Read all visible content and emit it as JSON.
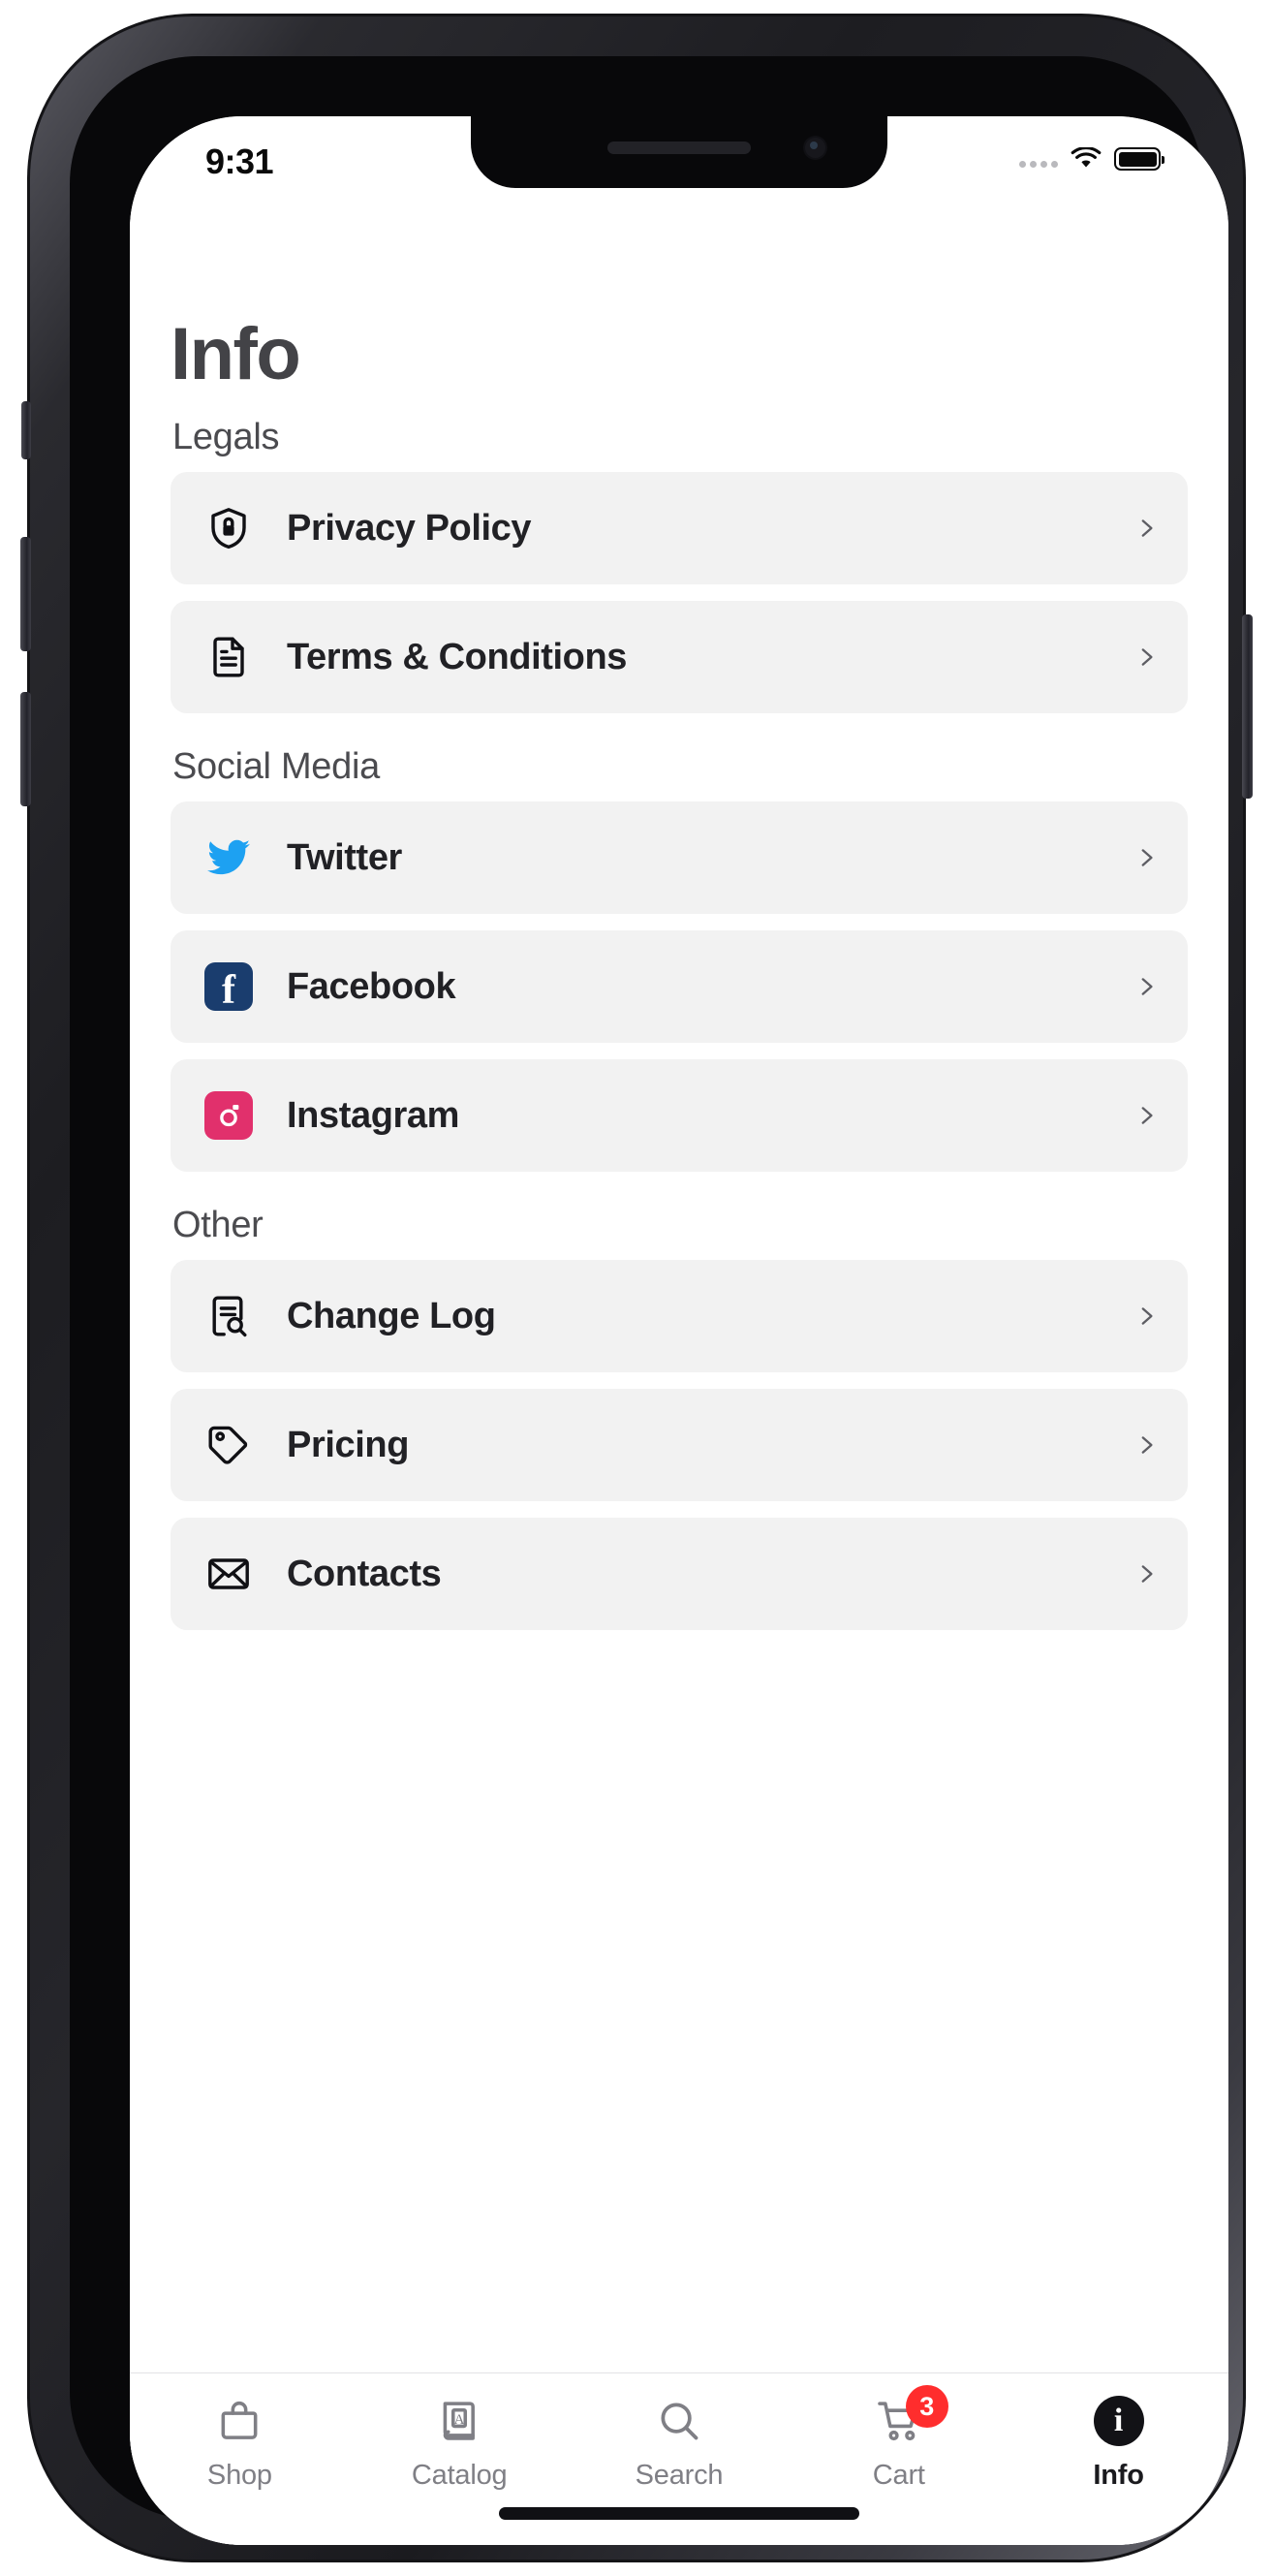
{
  "status_bar": {
    "time": "9:31",
    "signal_icon": "signal-dots-icon",
    "wifi_icon": "wifi-icon",
    "battery_icon": "battery-full-icon"
  },
  "page": {
    "title": "Info"
  },
  "sections": [
    {
      "header": "Legals",
      "rows": [
        {
          "label": "Privacy Policy",
          "icon": "shield-lock-icon",
          "chevron": "chevron-right-icon"
        },
        {
          "label": "Terms & Conditions",
          "icon": "document-icon",
          "chevron": "chevron-right-icon"
        }
      ]
    },
    {
      "header": "Social Media",
      "rows": [
        {
          "label": "Twitter",
          "icon": "twitter-icon",
          "chevron": "chevron-right-icon"
        },
        {
          "label": "Facebook",
          "icon": "facebook-icon",
          "chevron": "chevron-right-icon"
        },
        {
          "label": "Instagram",
          "icon": "instagram-icon",
          "chevron": "chevron-right-icon"
        }
      ]
    },
    {
      "header": "Other",
      "rows": [
        {
          "label": "Change Log",
          "icon": "document-search-icon",
          "chevron": "chevron-right-icon"
        },
        {
          "label": "Pricing",
          "icon": "price-tag-icon",
          "chevron": "chevron-right-icon"
        },
        {
          "label": "Contacts",
          "icon": "envelope-icon",
          "chevron": "chevron-right-icon"
        }
      ]
    }
  ],
  "tab_bar": {
    "tabs": [
      {
        "label": "Shop",
        "icon": "shopping-bag-icon",
        "active": false
      },
      {
        "label": "Catalog",
        "icon": "book-icon",
        "active": false
      },
      {
        "label": "Search",
        "icon": "magnifier-icon",
        "active": false
      },
      {
        "label": "Cart",
        "icon": "shopping-cart-icon",
        "active": false,
        "badge": "3"
      },
      {
        "label": "Info",
        "icon": "info-circle-icon",
        "active": true
      }
    ]
  },
  "colors": {
    "row_background": "#F2F2F2",
    "title_text": "#434347",
    "row_label_text": "#212125",
    "tab_inactive": "#7F7F85",
    "tab_active": "#1A1A1E",
    "badge_red": "#FF2D2D",
    "twitter_blue": "#1DA1F2",
    "facebook_blue": "#1A3D6E",
    "instagram_pink": "#E1306C"
  },
  "icon_glyphs": {
    "info_letter": "i",
    "facebook_letter": "f",
    "catalog_letter": "A"
  }
}
